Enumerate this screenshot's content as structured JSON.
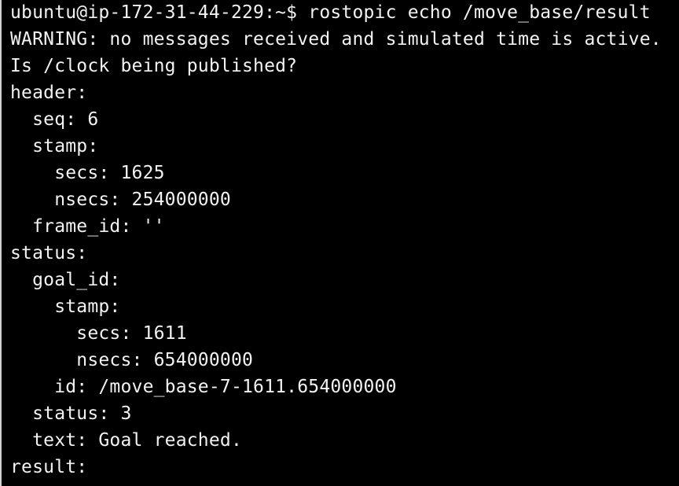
{
  "terminal": {
    "lines": [
      "ubuntu@ip-172-31-44-229:~$ rostopic echo /move_base/result",
      "WARNING: no messages received and simulated time is active.",
      "Is /clock being published?",
      "header:",
      "  seq: 6",
      "  stamp:",
      "    secs: 1625",
      "    nsecs: 254000000",
      "  frame_id: ''",
      "status:",
      "  goal_id:",
      "    stamp:",
      "      secs: 1611",
      "      nsecs: 654000000",
      "    id: /move_base-7-1611.654000000",
      "  status: 3",
      "  text: Goal reached.",
      "result:"
    ]
  }
}
